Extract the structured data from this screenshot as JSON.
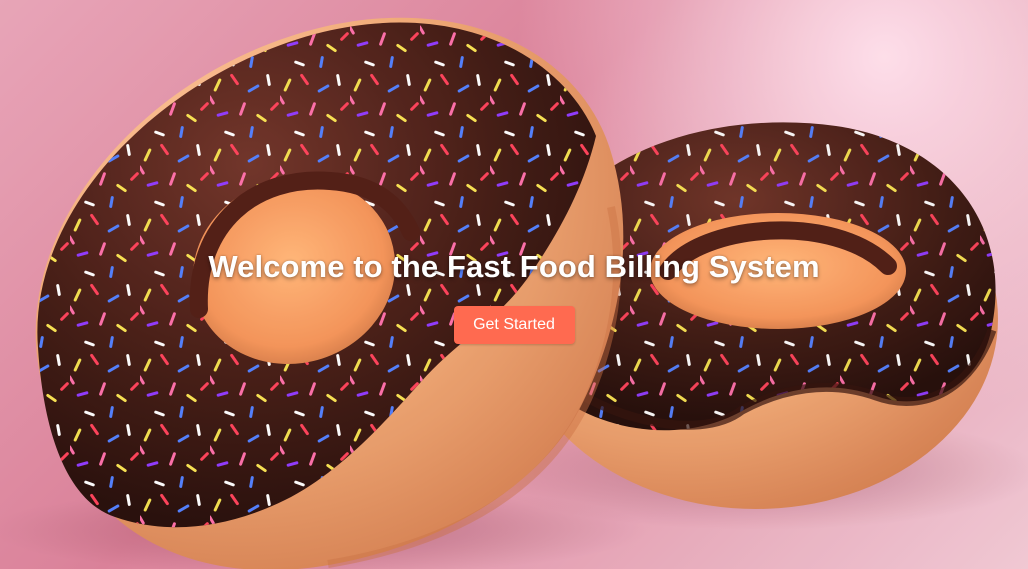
{
  "hero": {
    "title": "Welcome to the Fast Food Billing System",
    "cta_label": "Get Started",
    "accent_color": "#ff6a50"
  }
}
